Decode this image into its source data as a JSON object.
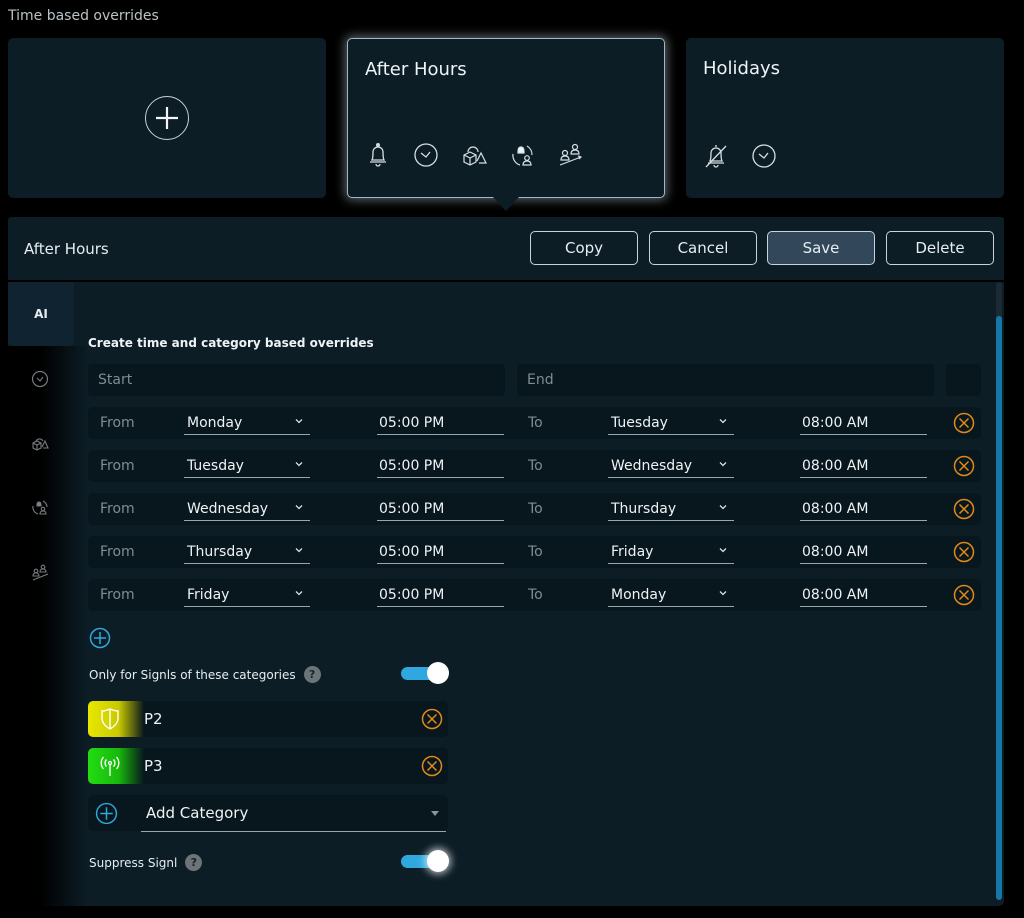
{
  "page": {
    "title": "Time based overrides"
  },
  "cards": [
    {
      "id": "add",
      "icon": "plus-circle-icon"
    },
    {
      "id": "after-hours",
      "title": "After Hours",
      "active": true,
      "icons": [
        "bell-icon",
        "clock-icon",
        "shapes-icon",
        "bell-rotate-user-icon",
        "users-escalate-icon"
      ]
    },
    {
      "id": "holidays",
      "title": "Holidays",
      "icons": [
        "bell-off-icon",
        "clock-icon"
      ]
    }
  ],
  "editor": {
    "title": "After Hours",
    "buttons": {
      "copy": "Copy",
      "cancel": "Cancel",
      "save": "Save",
      "delete": "Delete"
    }
  },
  "sidebar": {
    "active_tab": "AI",
    "icons": [
      "clock-icon",
      "shapes-icon",
      "bell-rotate-user-icon",
      "users-escalate-icon"
    ]
  },
  "schedule": {
    "heading": "Create time and category based overrides",
    "start_placeholder": "Start",
    "end_placeholder": "End",
    "from_label": "From",
    "to_label": "To",
    "rows": [
      {
        "from_day": "Monday",
        "from_time": "05:00 PM",
        "to_day": "Tuesday",
        "to_time": "08:00 AM"
      },
      {
        "from_day": "Tuesday",
        "from_time": "05:00 PM",
        "to_day": "Wednesday",
        "to_time": "08:00 AM"
      },
      {
        "from_day": "Wednesday",
        "from_time": "05:00 PM",
        "to_day": "Thursday",
        "to_time": "08:00 AM"
      },
      {
        "from_day": "Thursday",
        "from_time": "05:00 PM",
        "to_day": "Friday",
        "to_time": "08:00 AM"
      },
      {
        "from_day": "Friday",
        "from_time": "05:00 PM",
        "to_day": "Monday",
        "to_time": "08:00 AM"
      }
    ]
  },
  "categories": {
    "label": "Only for Signls of these categories",
    "help": "?",
    "enabled": true,
    "items": [
      {
        "name": "P2",
        "icon": "shield-icon",
        "color": "#e8e800"
      },
      {
        "name": "P3",
        "icon": "antenna-icon",
        "color": "#22dd11"
      }
    ],
    "add_label": "Add Category"
  },
  "suppress": {
    "label": "Suppress Signl",
    "help": "?",
    "enabled": true
  },
  "colors": {
    "accent": "#2fa8e0",
    "remove": "#e08a1a",
    "panel": "#0c1d26",
    "field": "#08161d"
  }
}
